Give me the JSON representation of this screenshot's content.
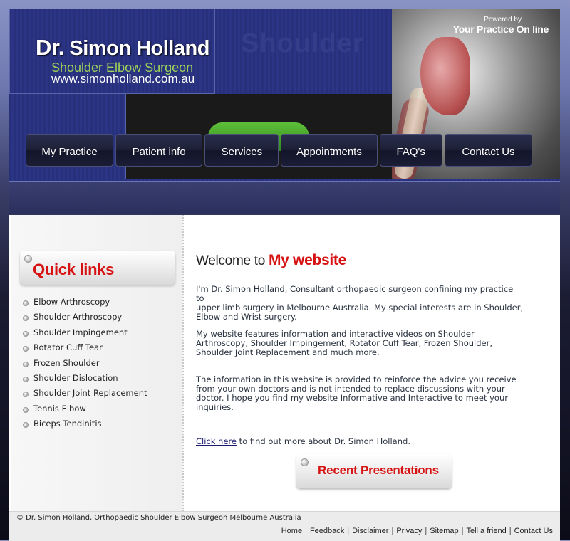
{
  "header": {
    "name_prefix": "Dr.",
    "name": "Simon Holland",
    "tagline": "Shoulder Elbow Surgeon",
    "url": "www.simonholland.com.au",
    "powered_small": "Powered by",
    "powered_large": "Your Practice On line",
    "ghost_text": "Shoulder"
  },
  "nav": [
    {
      "label": "My Practice"
    },
    {
      "label": "Patient info"
    },
    {
      "label": "Services"
    },
    {
      "label": "Appointments"
    },
    {
      "label": "FAQ's"
    },
    {
      "label": "Contact Us"
    }
  ],
  "sidebar": {
    "title": "Quick links",
    "items": [
      "Elbow Arthroscopy",
      "Shoulder Arthroscopy",
      "Shoulder Impingement",
      "Rotator Cuff Tear",
      "Frozen Shoulder",
      "Shoulder Dislocation",
      "Shoulder Joint Replacement",
      "Tennis Elbow",
      "Biceps Tendinitis"
    ]
  },
  "main": {
    "welcome_prefix": "Welcome to",
    "welcome_highlight": "My website",
    "para1": "I'm Dr. Simon Holland, Consultant orthopaedic surgeon confining my practice to",
    "para2": "upper limb surgery in Melbourne Australia. My special interests are in Shoulder, Elbow and Wrist surgery.",
    "para3": "My website features information and interactive videos on Shoulder Arthroscopy, Shoulder Impingement, Rotator Cuff Tear, Frozen Shoulder, Shoulder Joint Replacement and much more.",
    "para4": "The information in this website is provided to reinforce the advice you receive from your own doctors and is not intended to replace discussions with your doctor. I hope you find my website Informative and Interactive to meet your inquiries.",
    "click_link": "Click here",
    "click_rest": " to find out more about Dr. Simon Holland.",
    "recent_title": "Recent Presentations"
  },
  "footer": {
    "copyright": "© Dr. Simon Holland, Orthopaedic Shoulder Elbow Surgeon Melbourne Australia",
    "separator": "|",
    "links": [
      "Home",
      "Feedback",
      "Disclaimer",
      "Privacy",
      "Sitemap",
      "Tell a friend",
      "Contact Us"
    ]
  },
  "colors": {
    "accent_red": "#d71212",
    "tagline_green": "#9ed35a",
    "header_blue": "#2c3585",
    "nav_dark": "#1d2036"
  },
  "icons": {
    "bullet": "bullet-dot-icon",
    "heading_dot": "heading-dot-icon"
  }
}
